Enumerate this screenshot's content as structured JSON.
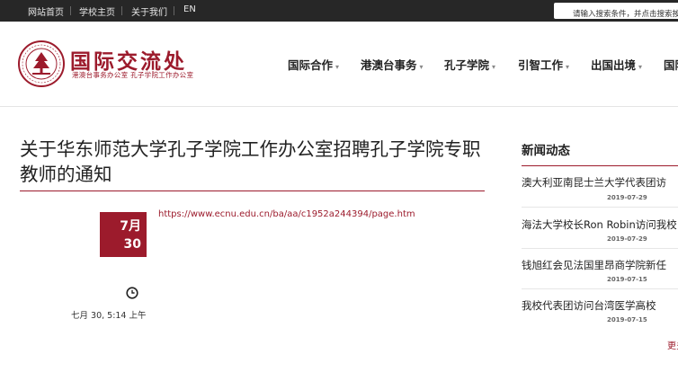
{
  "topbar": {
    "links": [
      "网站首页",
      "学校主页",
      "关于我们",
      "EN"
    ],
    "search_placeholder": "请输入搜索条件，并点击搜索按钮"
  },
  "header": {
    "site_title": "国际交流处",
    "site_subtitle": "港澳台事务办公室   孔子学院工作办公室",
    "nav": [
      "国际合作",
      "港澳台事务",
      "孔子学院",
      "引智工作",
      "出国出境",
      "国际"
    ]
  },
  "article": {
    "title": "关于华东师范大学孔子学院工作办公室招聘孔子学院专职教师的通知",
    "date_month": "7月",
    "date_day": "30",
    "posted_time": "七月 30, 5:14 上午",
    "link": "https://www.ecnu.edu.cn/ba/aa/c1952a244394/page.htm"
  },
  "sidebar": {
    "heading": "新闻动态",
    "items": [
      {
        "title": "澳大利亚南昆士兰大学代表团访",
        "date": "2019-07-29"
      },
      {
        "title": "海法大学校长Ron Robin访问我校",
        "date": "2019-07-29"
      },
      {
        "title": "钱旭红会见法国里昂商学院新任",
        "date": "2019-07-15"
      },
      {
        "title": "我校代表团访问台湾医学高校",
        "date": "2019-07-15"
      }
    ],
    "more": "更多"
  },
  "colors": {
    "brand": "#9c1b2c",
    "topbar": "#272727"
  }
}
